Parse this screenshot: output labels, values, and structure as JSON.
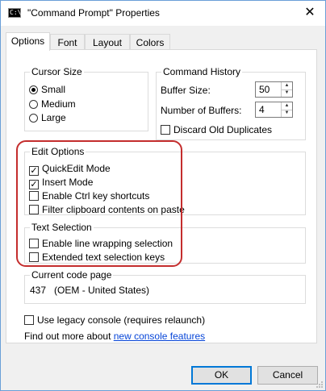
{
  "window": {
    "title": "\"Command Prompt\" Properties",
    "icon": "C:\\",
    "close_glyph": "✕"
  },
  "tabs": [
    {
      "label": "Options",
      "active": true
    },
    {
      "label": "Font",
      "active": false
    },
    {
      "label": "Layout",
      "active": false
    },
    {
      "label": "Colors",
      "active": false
    }
  ],
  "cursor_size": {
    "legend": "Cursor Size",
    "options": [
      {
        "label": "Small",
        "selected": true
      },
      {
        "label": "Medium",
        "selected": false
      },
      {
        "label": "Large",
        "selected": false
      }
    ]
  },
  "command_history": {
    "legend": "Command History",
    "buffer_size_label": "Buffer Size:",
    "buffer_size_value": "50",
    "num_buffers_label": "Number of Buffers:",
    "num_buffers_value": "4",
    "discard_label": "Discard Old Duplicates",
    "discard_checked": false
  },
  "edit_options": {
    "legend": "Edit Options",
    "items": [
      {
        "label": "QuickEdit Mode",
        "checked": true
      },
      {
        "label": "Insert Mode",
        "checked": true
      },
      {
        "label": "Enable Ctrl key shortcuts",
        "checked": false
      },
      {
        "label": "Filter clipboard contents on paste",
        "checked": false
      }
    ]
  },
  "text_selection": {
    "legend": "Text Selection",
    "items": [
      {
        "label": "Enable line wrapping selection",
        "checked": false
      },
      {
        "label": "Extended text selection keys",
        "checked": false
      }
    ]
  },
  "code_page": {
    "legend": "Current code page",
    "value": "437   (OEM - United States)"
  },
  "legacy": {
    "label": "Use legacy console (requires relaunch)",
    "checked": false
  },
  "find_out": {
    "prefix": "Find out more about ",
    "link": "new console features"
  },
  "buttons": {
    "ok": "OK",
    "cancel": "Cancel"
  },
  "colors": {
    "highlight": "#c42d2d",
    "link": "#0645d8",
    "default_button_border": "#0078d7"
  }
}
